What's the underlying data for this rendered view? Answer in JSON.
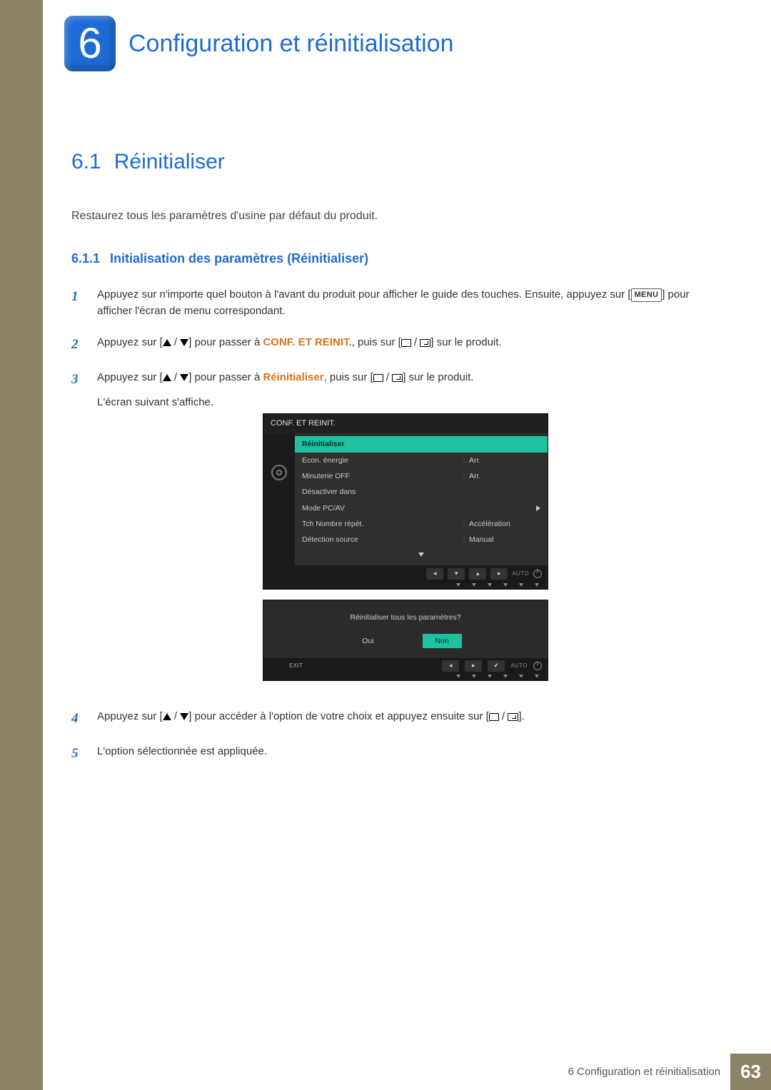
{
  "chapter": {
    "number": "6",
    "title": "Configuration et réinitialisation"
  },
  "section": {
    "number": "6.1",
    "title": "Réinitialiser"
  },
  "intro": "Restaurez tous les paramètres d'usine par défaut du produit.",
  "subsection": {
    "number": "6.1.1",
    "title": "Initialisation des paramètres (Réinitialiser)"
  },
  "steps": {
    "s1": {
      "num": "1",
      "a": "Appuyez sur n'importe quel bouton à l'avant du produit pour afficher le guide des touches. Ensuite, appuyez sur [",
      "menu": "MENU",
      "b": "] pour afficher l'écran de menu correspondant."
    },
    "s2": {
      "num": "2",
      "a": "Appuyez sur [",
      "b": "] pour passer à ",
      "key": "CONF. ET REINIT.",
      "c": ", puis sur [",
      "d": "] sur le produit."
    },
    "s3": {
      "num": "3",
      "a": "Appuyez sur [",
      "b": "] pour passer à ",
      "key": "Réinitialiser",
      "c": ", puis sur [",
      "d": "] sur le produit.",
      "e": "L'écran suivant s'affiche."
    },
    "s4": {
      "num": "4",
      "a": "Appuyez sur [",
      "b": "] pour accéder à l'option de votre choix et appuyez ensuite sur [",
      "c": "]."
    },
    "s5": {
      "num": "5",
      "text": "L'option sélectionnée est appliquée."
    }
  },
  "osd": {
    "title": "CONF. ET REINIT.",
    "rows": [
      {
        "label": "Réinitialiser",
        "value": "",
        "hi": true
      },
      {
        "label": "Econ. énergie",
        "value": "Arr."
      },
      {
        "label": "Minuterie OFF",
        "value": "Arr."
      },
      {
        "label": "Désactiver dans",
        "value": ""
      },
      {
        "label": "Mode PC/AV",
        "value": "",
        "arrow": true
      },
      {
        "label": "Tch Nombre répét.",
        "value": "Accélération"
      },
      {
        "label": "Détection source",
        "value": "Manual"
      }
    ],
    "nav_auto": "AUTO"
  },
  "dialog": {
    "question": "Réinitialiser tous les paramètres?",
    "yes": "Oui",
    "no": "Non",
    "exit": "EXIT",
    "auto": "AUTO"
  },
  "footer": {
    "label": "6 Configuration et réinitialisation",
    "page": "63"
  }
}
